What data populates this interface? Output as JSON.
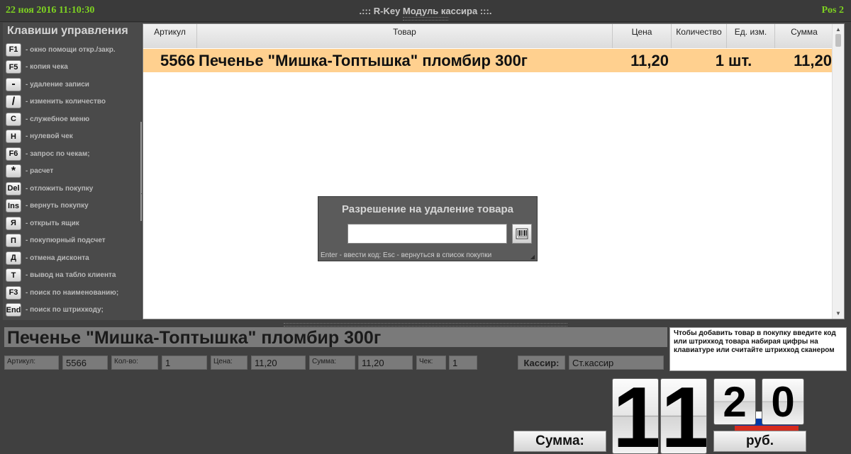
{
  "titlebar": {
    "datetime": "22 ноя 2016 11:10:30",
    "title": ".::: R-Key Модуль кассира :::.",
    "pos": "Pos 2"
  },
  "sidebar": {
    "title": "Клавиши управления",
    "hotkeys": [
      {
        "key": "F1",
        "desc": "- окно помощи откр./закр."
      },
      {
        "key": "F5",
        "desc": "- копия чека"
      },
      {
        "key": "-",
        "desc": "- удаление записи"
      },
      {
        "key": "/",
        "desc": "- изменить количество"
      },
      {
        "key": "C",
        "desc": "- служебное меню"
      },
      {
        "key": "H",
        "desc": "- нулевой чек"
      },
      {
        "key": "F6",
        "desc": "- запрос по чекам;"
      },
      {
        "key": "*",
        "desc": "- расчет"
      },
      {
        "key": "Del",
        "desc": "- отложить покупку"
      },
      {
        "key": "Ins",
        "desc": "- вернуть покупку"
      },
      {
        "key": "Я",
        "desc": "- открыть ящик"
      },
      {
        "key": "П",
        "desc": "- покупюрный подсчет"
      },
      {
        "key": "Д",
        "desc": "- отмена дисконта"
      },
      {
        "key": "T",
        "desc": "- вывод на табло клиента"
      },
      {
        "key": "F3",
        "desc": "- поиск по наименованию;"
      },
      {
        "key": "End",
        "desc": "- поиск по штрихкоду;"
      }
    ]
  },
  "grid": {
    "headers": [
      "Артикул",
      "Товар",
      "Цена",
      "Количество",
      "Ед. изм.",
      "Сумма"
    ],
    "rows": [
      {
        "article": "5566",
        "product": "Печенье \"Мишка-Топтышка\" пломбир 300г",
        "price": "11,20",
        "qty": "1",
        "unit": "шт.",
        "sum": "11,20"
      }
    ]
  },
  "dialog": {
    "title": "Разрешение на удаление товара",
    "input_value": "",
    "hint": "Enter - ввести код: Esc - вернуться в список покупки",
    "barcode_button_icon": "barcode-icon"
  },
  "info": {
    "product_name": "Печенье \"Мишка-Топтышка\" пломбир 300г",
    "help_text": "Чтобы добавить товар в покупку введите код или штрихкод товара набирая цифры на клавиатуре или считайте штрихкод сканером",
    "fields": {
      "article_label": "Артикул:",
      "article_value": "5566",
      "qty_label": "Кол-во:",
      "qty_value": "1",
      "price_label": "Цена:",
      "price_value": "11,20",
      "sum_label": "Сумма:",
      "sum_value": "11,20",
      "check_label": "Чек:",
      "check_value": "1",
      "cashier_label": "Кассир:",
      "cashier_value": "Ст.кассир"
    }
  },
  "total": {
    "label": "Сумма:",
    "digits": [
      "1",
      "1",
      "2",
      "0"
    ],
    "currency": "руб."
  },
  "colors": {
    "accent_green": "#7ed321",
    "selected_row": "#ffd08f",
    "flag": [
      "#ffffff",
      "#0039a6",
      "#d52b1e"
    ]
  }
}
